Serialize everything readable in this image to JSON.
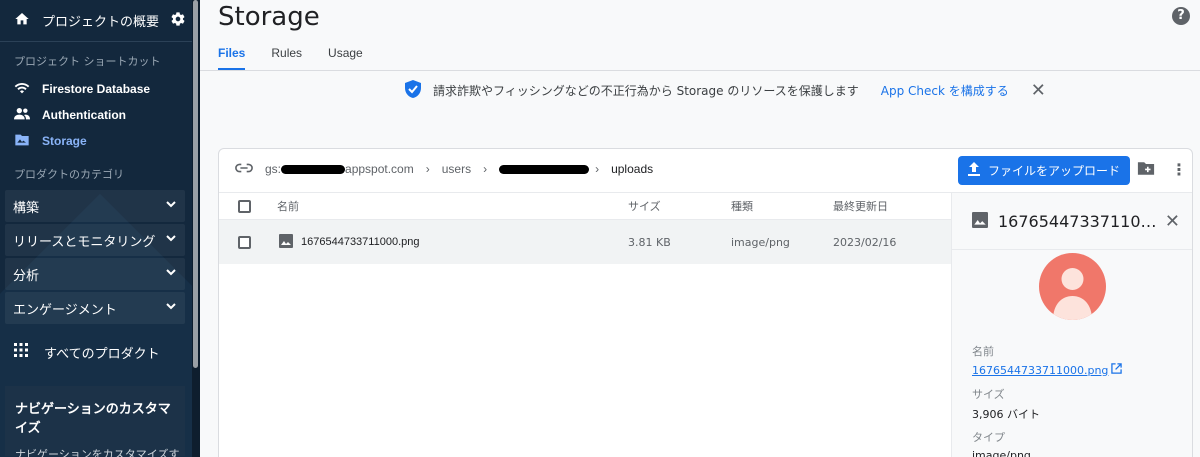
{
  "sidebar": {
    "project_overview": "プロジェクトの概要",
    "shortcuts_title": "プロジェクト ショートカット",
    "shortcuts": [
      {
        "label": "Firestore Database",
        "icon": "wifi-icon"
      },
      {
        "label": "Authentication",
        "icon": "people-icon"
      },
      {
        "label": "Storage",
        "icon": "folder-icon",
        "active": true
      }
    ],
    "categories_title": "プロダクトのカテゴリ",
    "categories": [
      "構築",
      "リリースとモニタリング",
      "分析",
      "エンゲージメント"
    ],
    "all_products": "すべてのプロダクト",
    "customize_title": "ナビゲーションのカスタマイズ",
    "customize_text": "ナビゲーションをカスタマイズす"
  },
  "header": {
    "title": "Storage",
    "help": "?",
    "tabs": [
      {
        "label": "Files",
        "active": true
      },
      {
        "label": "Rules"
      },
      {
        "label": "Usage"
      }
    ]
  },
  "banner": {
    "text": "請求詐欺やフィッシングなどの不正行為から Storage のリソースを保護します",
    "link": "App Check を構成する"
  },
  "path": {
    "prefix": "gs:",
    "bucket_suffix": "appspot.com",
    "users": "users",
    "uploads": "uploads"
  },
  "upload_button": "ファイルをアップロード",
  "table": {
    "columns": [
      "名前",
      "サイズ",
      "種類",
      "最終更新日"
    ],
    "rows": [
      {
        "name": "1676544733711000.png",
        "size": "3.81 KB",
        "type": "image/png",
        "modified": "2023/02/16"
      }
    ]
  },
  "panel": {
    "title": "167654473371100...",
    "name_label": "名前",
    "name_value": "1676544733711000.png",
    "size_label": "サイズ",
    "size_value": "3,906 バイト",
    "type_label": "タイプ",
    "type_value": "image/png"
  },
  "colors": {
    "sidebar_bg": "#13283d",
    "accent": "#1a73e8",
    "avatar_bg": "#f0776a"
  }
}
